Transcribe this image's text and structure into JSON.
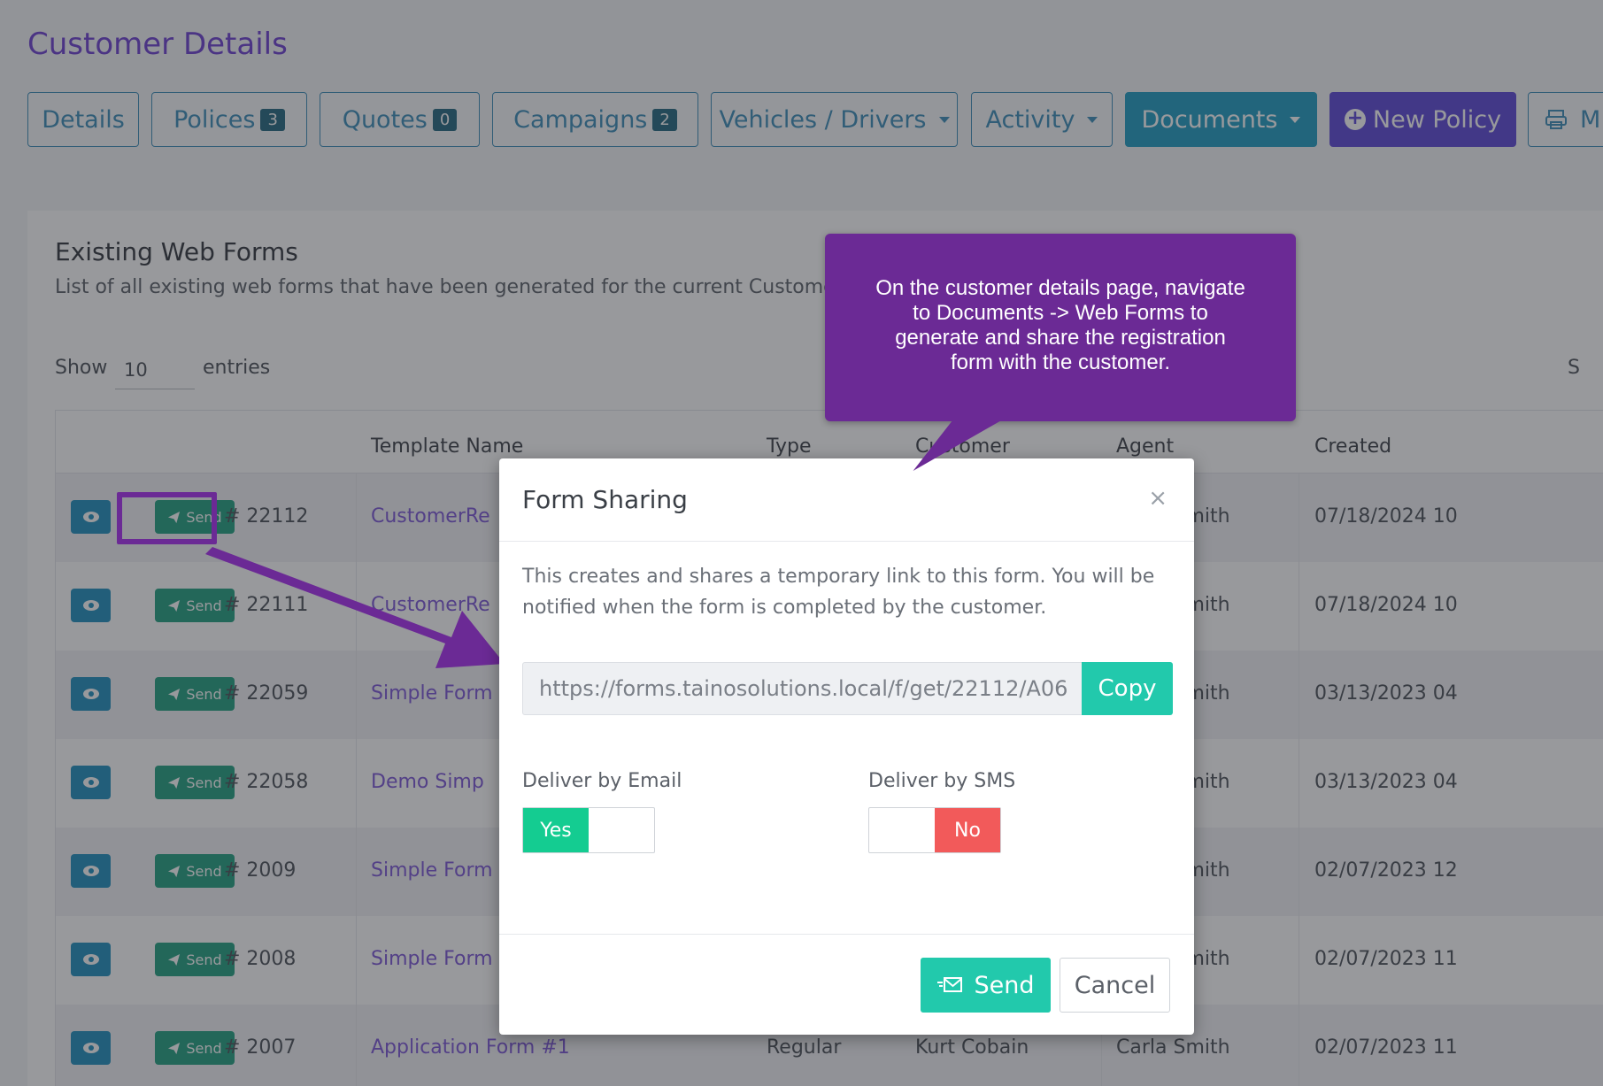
{
  "page": {
    "title": "Customer Details"
  },
  "tabs": [
    {
      "label": "Details",
      "badge": ""
    },
    {
      "label": "Polices",
      "badge": "3"
    },
    {
      "label": "Quotes",
      "badge": "0"
    },
    {
      "label": "Campaigns",
      "badge": "2"
    },
    {
      "label": "Vehicles / Drivers",
      "badge": ""
    },
    {
      "label": "Activity",
      "badge": ""
    },
    {
      "label": "Documents",
      "badge": ""
    },
    {
      "label": "New Policy",
      "badge": ""
    },
    {
      "label": "M",
      "badge": ""
    }
  ],
  "card": {
    "title": "Existing Web Forms",
    "subtitle": "List of all existing web forms that have been generated for the current Customer",
    "show_label": "Show",
    "show_value": "10",
    "entries_label": "entries",
    "search_partial": "S"
  },
  "table": {
    "headers": {
      "template": "Template Name",
      "type": "Type",
      "customer": "Customer",
      "agent": "Agent",
      "created": "Created"
    },
    "send_label": "Send",
    "rows": [
      {
        "id": "# 22112",
        "template": "CustomerRe",
        "type": "",
        "customer": "",
        "agent": "Carla Smith",
        "created": "07/18/2024 10"
      },
      {
        "id": "# 22111",
        "template": "CustomerRe",
        "type": "",
        "customer": "",
        "agent": "Carla Smith",
        "created": "07/18/2024 10"
      },
      {
        "id": "# 22059",
        "template": "Simple Form",
        "type": "",
        "customer": "",
        "agent": "Carla Smith",
        "created": "03/13/2023 04"
      },
      {
        "id": "# 22058",
        "template": "Demo Simp",
        "type": "",
        "customer": "",
        "agent": "Carla Smith",
        "created": "03/13/2023 04"
      },
      {
        "id": "# 2009",
        "template": "Simple Form",
        "type": "",
        "customer": "",
        "agent": "Carla Smith",
        "created": "02/07/2023 12"
      },
      {
        "id": "# 2008",
        "template": "Simple Form",
        "type": "",
        "customer": "",
        "agent": "Carla Smith",
        "created": "02/07/2023 11"
      },
      {
        "id": "# 2007",
        "template": "Application Form #1",
        "type": "Regular",
        "customer": "Kurt Cobain",
        "agent": "Carla Smith",
        "created": "02/07/2023 11"
      }
    ]
  },
  "modal": {
    "title": "Form Sharing",
    "close": "×",
    "description": "This creates and shares a temporary link to this form. You will be notified when the form is completed by the customer.",
    "link_value": "https://forms.tainosolutions.local/f/get/22112/A06",
    "copy_label": "Copy",
    "email_label": "Deliver by Email",
    "email_toggle": "Yes",
    "sms_label": "Deliver by SMS",
    "sms_toggle": "No",
    "send_label": "Send",
    "cancel_label": "Cancel"
  },
  "callout": {
    "text": "On the customer details page, navigate to Documents -> Web Forms to generate and share the registration form with the customer."
  },
  "colors": {
    "accent_purple": "#6c3fd1",
    "tab_blue": "#3b8db8",
    "send_green": "#1f9f7f",
    "copy_teal": "#22c9ac",
    "yes_green": "#14cc91",
    "no_red": "#f25a5a",
    "callout_purple": "#6b2a95"
  }
}
